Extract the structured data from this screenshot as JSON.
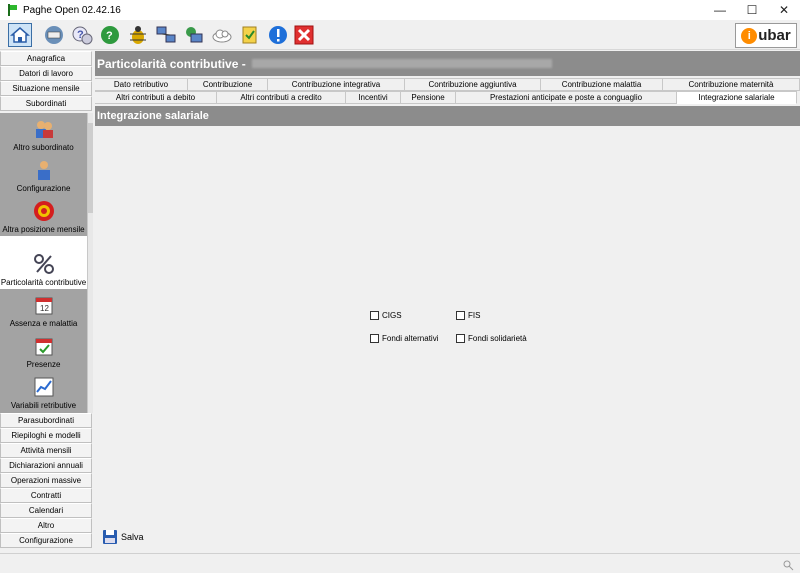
{
  "window": {
    "title": "Paghe Open 02.42.16",
    "minimize": "—",
    "maximize": "☐",
    "close": "✕"
  },
  "toolbar": {
    "icons": [
      "home-icon",
      "network-icon",
      "help-icon",
      "globe-help-icon",
      "bug-icon",
      "computers-icon",
      "sync-icon",
      "cloud-icon",
      "notes-icon",
      "info-icon",
      "exit-icon"
    ],
    "logo_text": "ubar",
    "logo_ring": "i"
  },
  "sidebar": {
    "top_items": [
      "Anagrafica",
      "Datori di lavoro",
      "Situazione mensile",
      "Subordinati"
    ],
    "sub_items": [
      {
        "label": "Altro subordinato",
        "icon": "people-icon"
      },
      {
        "label": "Configurazione",
        "icon": "person-config-icon"
      },
      {
        "label": "Altra posizione mensile",
        "icon": "target-icon"
      },
      {
        "label": "Particolarità contributive",
        "icon": "percent-icon",
        "active": true
      },
      {
        "label": "Assenza e malattia",
        "icon": "calendar-icon"
      },
      {
        "label": "Presenze",
        "icon": "presence-icon"
      },
      {
        "label": "Variabili retributive",
        "icon": "chart-icon"
      }
    ],
    "bottom_items": [
      "Parasubordinati",
      "Riepiloghi e modelli",
      "Attività mensili",
      "Dichiarazioni annuali",
      "Operazioni massive",
      "Contratti",
      "Calendari",
      "Altro",
      "Configurazione"
    ]
  },
  "main": {
    "header_title": "Particolarità contributive -",
    "tabs_row1": [
      "Dato retributivo",
      "Contribuzione",
      "Contribuzione integrativa",
      "Contribuzione aggiuntiva",
      "Contribuzione malattia",
      "Contribuzione maternità"
    ],
    "tabs_row2": [
      "Altri contributi a debito",
      "Altri contributi a credito",
      "Incentivi",
      "Pensione",
      "Prestazioni anticipate e poste a conguaglio",
      "Integrazione salariale"
    ],
    "section_title": "Integrazione salariale",
    "checkboxes": [
      {
        "label": "CIGS",
        "checked": false
      },
      {
        "label": "FIS",
        "checked": false
      },
      {
        "label": "Fondi alternativi",
        "checked": false
      },
      {
        "label": "Fondi solidarietà",
        "checked": false
      }
    ],
    "save_label": "Salva"
  }
}
